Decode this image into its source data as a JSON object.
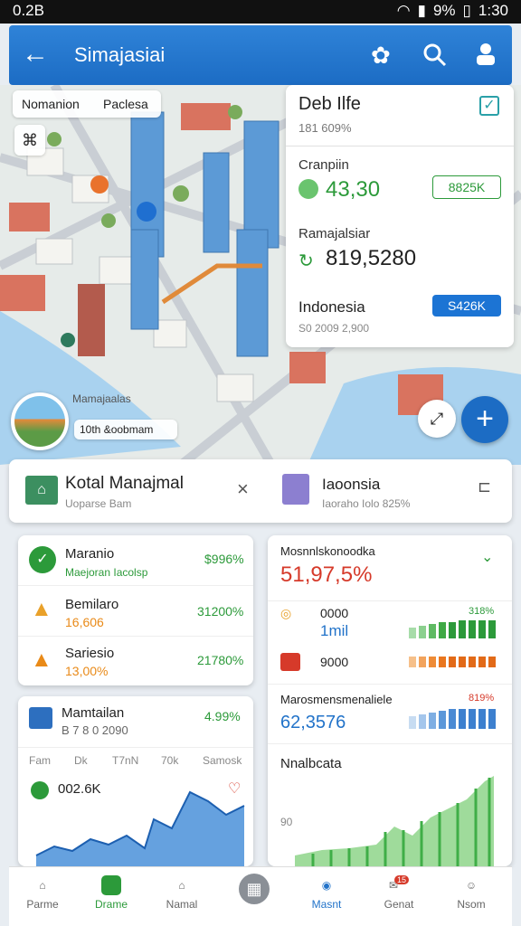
{
  "status": {
    "time": "0.2B",
    "right": "9%",
    "clock": "1:30"
  },
  "appbar": {
    "title": "Simajasiai"
  },
  "map": {
    "chip_left": "Nomanion",
    "chip_right": "Paclesa",
    "scale_label": "10th &oobmam",
    "sea_label": "Mamajaalas"
  },
  "overlay": {
    "title": "Deb Ilfe",
    "subtitle": "181 609%",
    "r1_label": "Cranpiin",
    "r1_value": "43,30",
    "r1_pill": "8825K",
    "r2_label": "Ramajalsiar",
    "r2_value": "819,5280",
    "r3_label": "Indonesia",
    "r3_pill": "S426K",
    "r3_sub": "S0 2009 2,900"
  },
  "info_left": {
    "title": "Kotal Manajmal",
    "sub": "Uoparse Bam"
  },
  "info_right": {
    "title": "Iaoonsia",
    "sub": "Iaoraho Iolo 825%"
  },
  "list_card": {
    "items": [
      {
        "name": "Maranio",
        "sub": "Maejoran Iacolsp",
        "value": "$996%"
      },
      {
        "name": "Bemilaro",
        "sub": "16,606",
        "value": "31200%"
      },
      {
        "name": "Sariesio",
        "sub": "13,00%",
        "value": "21780%"
      }
    ]
  },
  "stats_card": {
    "title": "Mamtailan",
    "sub": "B 7 8 0 2090",
    "value": "4.99%",
    "cols": [
      "Fam",
      "Dk",
      "T7nN",
      "70k",
      "Samosk"
    ],
    "big": "002.6K"
  },
  "right_card": {
    "title": "Mosnnlskonoodka",
    "big": "51,97,5%",
    "r1_value": "0000",
    "r1_sub": "1mil",
    "r1_pct": "318%",
    "r2_value": "9000",
    "r3_title": "Marosmensmenaliele",
    "r3_value": "62,3576",
    "r3_pct": "819%",
    "r4_title": "Nnalbcata",
    "axis": "90"
  },
  "nav": {
    "items": [
      "Parme",
      "Drame",
      "Namal",
      "",
      "Masnt",
      "Genat",
      "Nsom"
    ],
    "badge": "15"
  },
  "colors": {
    "accent": "#1c6cc4",
    "green": "#2c9a3a",
    "orange": "#e98a18",
    "red": "#d63a2a"
  }
}
